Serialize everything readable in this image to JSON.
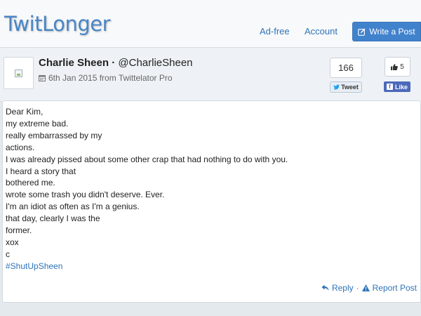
{
  "navbar": {
    "logo": "TwitLonger",
    "links": [
      "Ad-free",
      "Account"
    ],
    "write_label": "Write a Post",
    "write_icon": "edit-icon"
  },
  "post_header": {
    "author_name": "Charlie Sheen",
    "separator": "·",
    "handle": "@CharlieSheen",
    "date": "6th Jan 2015 from Twittelator Pro",
    "date_icon": "calendar-icon"
  },
  "social": {
    "tweet_count": "166",
    "tweet_label": "Tweet",
    "like_count": "5",
    "like_label": "Like"
  },
  "post_body": {
    "lines": [
      "Dear Kim,",
      "my extreme bad.",
      "really embarrassed by my",
      "actions.",
      "I was already pissed about some other crap that had nothing to do with you.",
      "I heard a story that",
      "bothered me.",
      "wrote some trash you didn't deserve. Ever.",
      "I'm an idiot as often as I'm a genius.",
      "that day, clearly I was the",
      "former.",
      "xox",
      "c"
    ],
    "hashtag": "#ShutUpSheen"
  },
  "actions": {
    "reply_label": "Reply",
    "separator": "·",
    "report_label": "Report Post"
  },
  "colors": {
    "accent": "#4182cd",
    "link": "#2f74b9",
    "facebook": "#4c69ba",
    "page_background": "#e4e9ee"
  }
}
